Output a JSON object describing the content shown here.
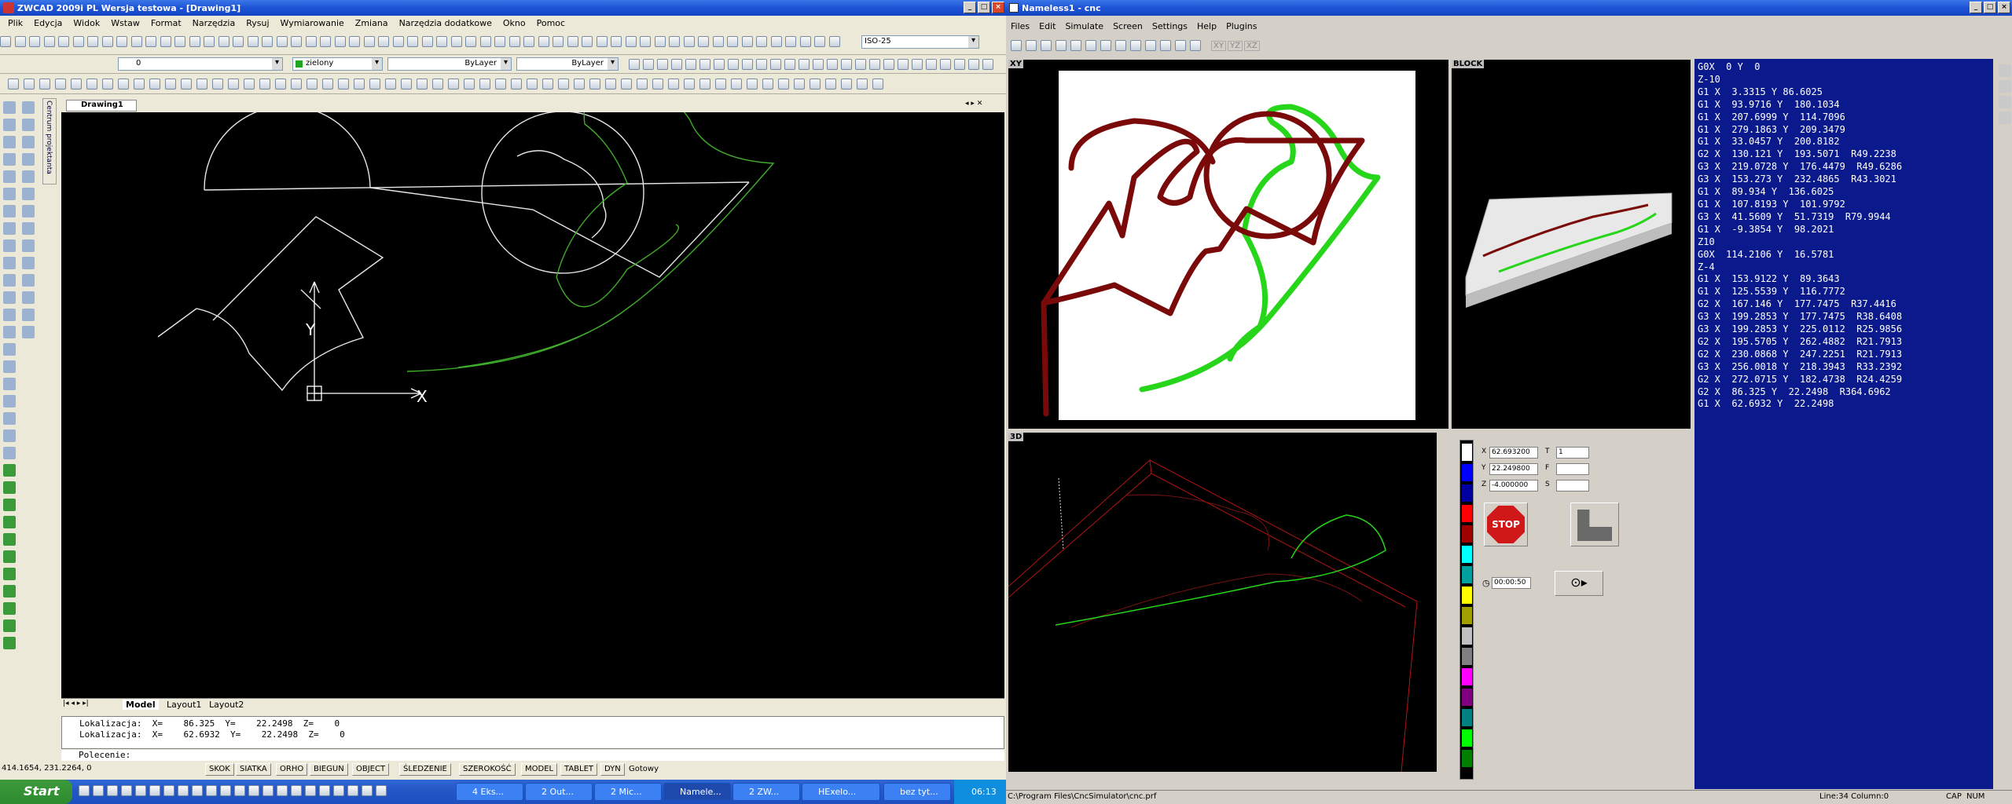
{
  "zwcad": {
    "title": "ZWCAD 2009i PL Wersja testowa - [Drawing1]",
    "menu": [
      "Plik",
      "Edycja",
      "Widok",
      "Wstaw",
      "Format",
      "Narzędzia",
      "Rysuj",
      "Wymiarowanie",
      "Zmiana",
      "Narzędzia dodatkowe",
      "Okno",
      "Pomoc"
    ],
    "dimstyle_combo": "ISO-25",
    "layer_combo": "0",
    "color_combo": "zielony",
    "linetype_combo": "ByLayer",
    "lineweight_combo": "ByLayer",
    "drawing_tab": "Drawing1",
    "side_tab": "Centrum projektanta",
    "layout_tabs": [
      "Model",
      "Layout1",
      "Layout2"
    ],
    "command_history": [
      "Lokalizacja:  X=    86.325  Y=    22.2498  Z=    0",
      "Lokalizacja:  X=    62.6932  Y=    22.2498  Z=    0"
    ],
    "command_prompt": "Polecenie:",
    "coords": "414.1654, 231.2264, 0",
    "status_buttons": [
      "SKOK",
      "SIATKA",
      "ORHO",
      "BIEGUN",
      "OBJECT",
      "ŚLEDZENIE",
      "SZEROKOŚĆ",
      "MODEL",
      "TABLET",
      "DYN"
    ],
    "status_text": "Gotowy",
    "ucs": {
      "x_label": "X",
      "y_label": "Y"
    },
    "colors": {
      "drawing_line": "#e6e6e6",
      "toolpath": "#3fae2a",
      "background": "#000000"
    }
  },
  "cnc": {
    "title": "Nameless1 - cnc",
    "menu": [
      "Files",
      "Edit",
      "Simulate",
      "Screen",
      "Settings",
      "Help",
      "Plugins"
    ],
    "view_buttons": [
      "XY",
      "YZ",
      "XZ"
    ],
    "panels": {
      "xy": "XY",
      "block": "BLOCK",
      "view3d": "3D"
    },
    "gcode": [
      "G0X  0 Y  0",
      "Z-10",
      "G1 X  3.3315 Y 86.6025",
      "G1 X  93.9716 Y  180.1034",
      "G1 X  207.6999 Y  114.7096",
      "G1 X  279.1863 Y  209.3479",
      "G1 X  33.0457 Y  200.8182",
      "G2 X  130.121 Y  193.5071  R49.2238",
      "G3 X  219.0728 Y  176.4479  R49.6286",
      "G3 X  153.273 Y  232.4865  R43.3021",
      "G1 X  89.934 Y  136.6025",
      "G1 X  107.8193 Y  101.9792",
      "G3 X  41.5609 Y  51.7319  R79.9944",
      "G1 X  -9.3854 Y  98.2021",
      "Z10",
      "G0X  114.2106 Y  16.5781",
      "Z-4",
      "G1 X  153.9122 Y  89.3643",
      "G1 X  125.5539 Y  116.7772",
      "G2 X  167.146 Y  177.7475  R37.4416",
      "G3 X  199.2853 Y  177.7475  R38.6408",
      "G3 X  199.2853 Y  225.0112  R25.9856",
      "G2 X  195.5705 Y  262.4882  R21.7913",
      "G2 X  230.0868 Y  247.2251  R21.7913",
      "G3 X  256.0018 Y  218.3943  R33.2392",
      "G2 X  272.0715 Y  182.4738  R24.4259",
      "G2 X  86.325 Y  22.2498  R364.6962",
      "G1 X  62.6932 Y  22.2498"
    ],
    "position": {
      "x_label": "X",
      "x": "62.693200",
      "y_label": "Y",
      "y": "22.249800",
      "z_label": "Z",
      "z": "-4.000000",
      "t_label": "T",
      "t": "1",
      "f_label": "F",
      "s_label": "S"
    },
    "stop_label": "STOP",
    "time": "00:00:50",
    "statusbar_path": "C:\\Program Files\\CncSimulator\\cnc.prf",
    "statusbar_pos": "Line:34 Column:0",
    "statusbar_caps": "CAP",
    "statusbar_num": "NUM",
    "colors": {
      "path_red": "#7a0a0a",
      "path_green": "#27d61b",
      "gcode_bg": "#0a1a8c"
    },
    "palette": [
      "#ffffff",
      "#0000ff",
      "#0000a0",
      "#ff0000",
      "#a00000",
      "#00ffff",
      "#00a0a0",
      "#ffff00",
      "#a0a000",
      "#c0c0c0",
      "#808080",
      "#ff00ff",
      "#800080",
      "#008080",
      "#00ff00",
      "#008000"
    ]
  },
  "taskbar": {
    "start": "Start",
    "tasks": [
      "4 Eks...",
      "2 Out...",
      "2 Mic...",
      "Namele...",
      "2 ZW...",
      "HExelo...",
      "bez tyt..."
    ],
    "clock": "06:13"
  }
}
